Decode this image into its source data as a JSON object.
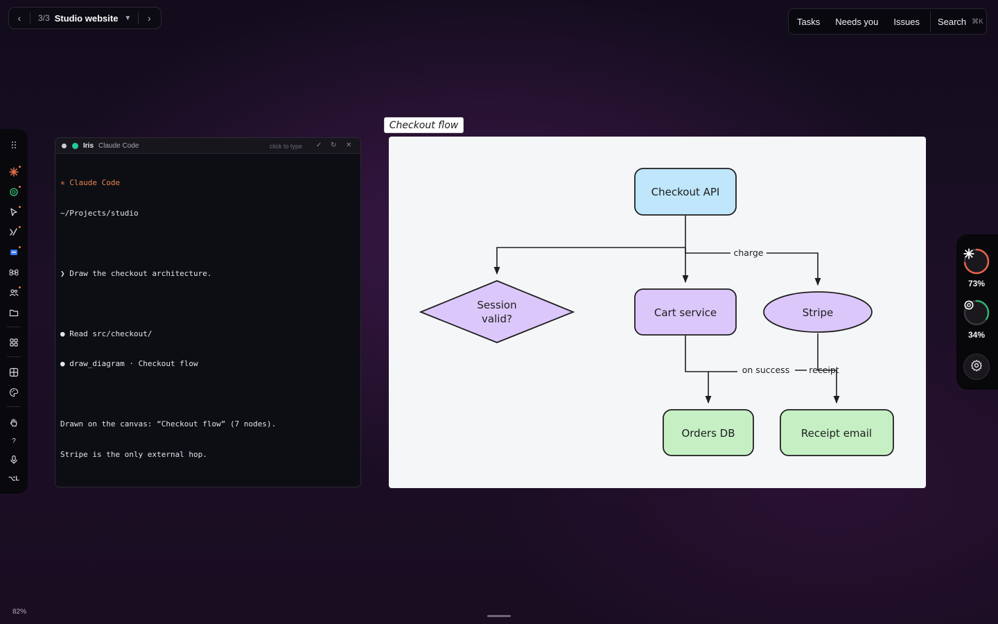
{
  "breadcrumb": {
    "count": "3/3",
    "title": "Studio website"
  },
  "topnav": {
    "tasks": "Tasks",
    "needs_you": "Needs you",
    "issues": "Issues",
    "search": "Search",
    "search_shortcut": "⌘K"
  },
  "dock": {
    "items": [
      "drag-handle-icon",
      "claude-icon",
      "openai-icon",
      "cursor-icon",
      "code-agent-icon",
      "chat-badge-icon",
      "command-icon",
      "team-icon",
      "folder-icon",
      "apps-grid-icon",
      "layout-icon",
      "palette-icon",
      "hand-icon",
      "help-icon",
      "microphone-icon",
      "shortcut-icon"
    ],
    "help_label": "?",
    "shortcut_label": "⌥L"
  },
  "terminal": {
    "agent_name": "Iris",
    "app_name": "Claude Code",
    "hint": "click to type",
    "lines": [
      "✳ Claude Code",
      "~/Projects/studio",
      "",
      "❯ Draw the checkout architecture.",
      "",
      "● Read src/checkout/",
      "● draw_diagram · Checkout flow",
      "",
      "Drawn on the canvas: “Checkout flow” (7 nodes).",
      "Stripe is the only external hop."
    ]
  },
  "diagram": {
    "title": "Checkout flow",
    "nodes": {
      "checkout_api": "Checkout API",
      "session_line1": "Session",
      "session_line2": "valid?",
      "cart_service": "Cart service",
      "stripe": "Stripe",
      "orders_db": "Orders DB",
      "receipt_email": "Receipt email"
    },
    "edges": {
      "charge": "charge",
      "on_success": "on success",
      "receipt": "receipt"
    },
    "colors": {
      "blue": "#bfe6fb",
      "purple": "#dcc7fa",
      "green": "#c6f0c4",
      "stroke": "#1e1e1e"
    }
  },
  "usage": {
    "claude_pct": "73%",
    "claude_value": 0.73,
    "openai_pct": "34%",
    "openai_value": 0.34,
    "claude_color": "#e8634a",
    "openai_color": "#2fb36d"
  },
  "status": {
    "zoom": "82%"
  }
}
